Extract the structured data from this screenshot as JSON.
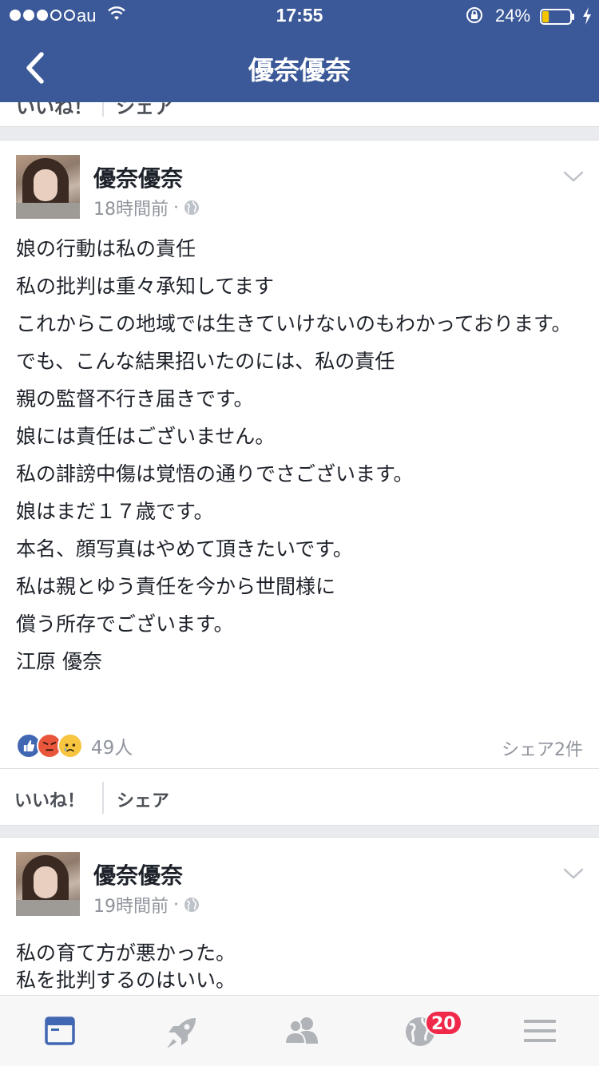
{
  "status_bar": {
    "carrier": "au",
    "time": "17:55",
    "battery_percent": "24%",
    "battery_level": 0.24,
    "signal_bars_filled": 3,
    "signal_bars_total": 5
  },
  "header": {
    "title": "優奈優奈",
    "accent": "#3b5998"
  },
  "previous_card": {
    "fragment_left": "いいね！",
    "fragment_right": "シェア"
  },
  "posts": [
    {
      "author": "優奈優奈",
      "time": "18時間前",
      "separator": "·",
      "lines": [
        "娘の行動は私の責任",
        "私の批判は重々承知してます",
        "これからこの地域では生きていけないのもわかっております。",
        "でも、こんな結果招いたのには、私の責任",
        "親の監督不行き届きです。",
        "娘には責任はございません。",
        "私の誹謗中傷は覚悟の通りでさございます。",
        "娘はまだ１７歳です。",
        "本名、顔写真はやめて頂きたいです。",
        "私は親とゆう責任を今から世間様に",
        "償う所存でございます。",
        "江原 優奈"
      ],
      "reactions": [
        "like",
        "angry",
        "sad"
      ],
      "reaction_count": "49人",
      "share_count": "シェア2件",
      "like_label": "いいね！",
      "share_label": "シェア"
    },
    {
      "author": "優奈優奈",
      "time": "19時間前",
      "separator": "·",
      "lines": [
        "私の育て方が悪かった。",
        "私を批判するのはいい。"
      ]
    }
  ],
  "tabbar": {
    "items": [
      "news-feed",
      "rocket",
      "friends",
      "notifications-globe",
      "menu"
    ],
    "notification_badge": "20",
    "active_color": "#4267b2",
    "inactive_color": "#b0b3b8"
  }
}
